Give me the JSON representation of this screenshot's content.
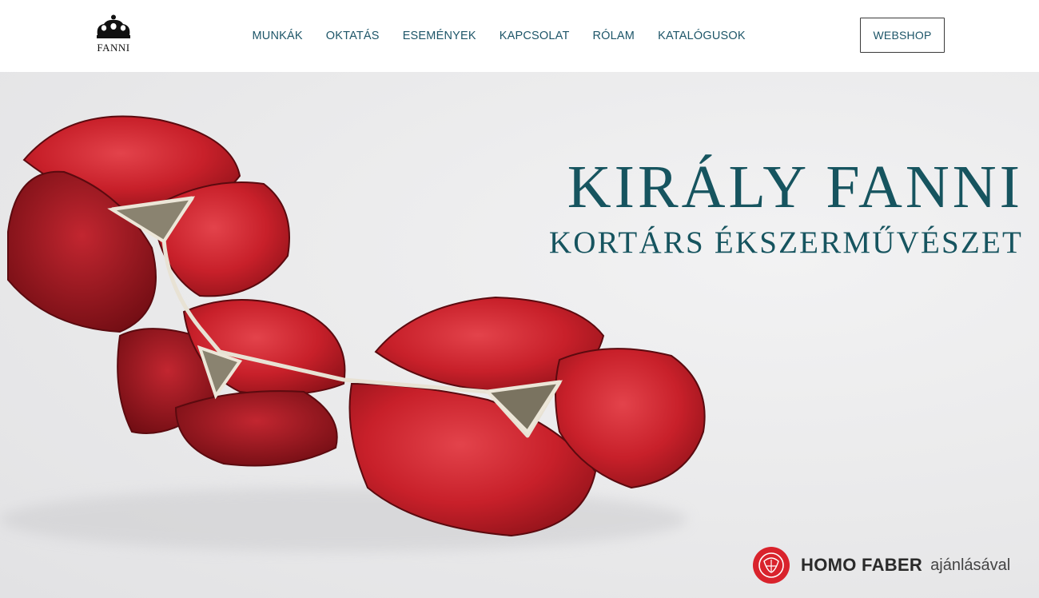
{
  "logo": {
    "text": "FANNI",
    "icon": "crown-icon"
  },
  "nav": {
    "items": [
      {
        "label": "MUNKÁK"
      },
      {
        "label": "OKTATÁS"
      },
      {
        "label": "ESEMÉNYEK"
      },
      {
        "label": "KAPCSOLAT"
      },
      {
        "label": "RÓLAM"
      },
      {
        "label": "KATALÓGUSOK"
      }
    ],
    "webshop_label": "WEBSHOP"
  },
  "hero": {
    "title": "KIRÁLY FANNI",
    "subtitle": "KORTÁRS ÉKSZERMŰVÉSZET",
    "image": "red-leather-flower-brooch",
    "badge": {
      "icon": "homo-faber-logo-icon",
      "name": "HOMO FABER",
      "suffix": "ajánlásával"
    }
  },
  "colors": {
    "accent": "#16545f",
    "nav_text": "#1d5568",
    "flower_red": "#c8202a",
    "badge_red": "#d9232c",
    "background": "#ebebec"
  }
}
